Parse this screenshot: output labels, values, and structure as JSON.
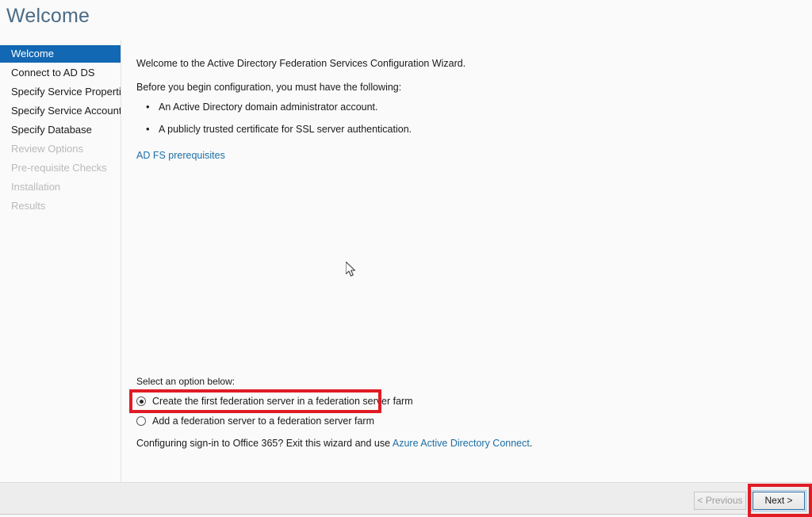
{
  "header": {
    "title": "Welcome"
  },
  "sidebar": {
    "items": [
      {
        "label": "Welcome",
        "state": "selected"
      },
      {
        "label": "Connect to AD DS",
        "state": "enabled"
      },
      {
        "label": "Specify Service Properties",
        "state": "enabled"
      },
      {
        "label": "Specify Service Account",
        "state": "enabled"
      },
      {
        "label": "Specify Database",
        "state": "enabled"
      },
      {
        "label": "Review Options",
        "state": "disabled"
      },
      {
        "label": "Pre-requisite Checks",
        "state": "disabled"
      },
      {
        "label": "Installation",
        "state": "disabled"
      },
      {
        "label": "Results",
        "state": "disabled"
      }
    ]
  },
  "content": {
    "intro_line_1": "Welcome to the Active Directory Federation Services Configuration Wizard.",
    "intro_line_2": "Before you begin configuration, you must have the following:",
    "requirements": [
      "An Active Directory domain administrator account.",
      "A publicly trusted certificate for SSL server authentication."
    ],
    "prerequisites_link": "AD FS prerequisites",
    "option_label": "Select an option below:",
    "options": [
      {
        "label": "Create the first federation server in a federation server farm",
        "selected": true
      },
      {
        "label": "Add a federation server to a federation server farm",
        "selected": false
      }
    ],
    "office_note_prefix": "Configuring sign-in to Office 365? Exit this wizard and use ",
    "office_note_link": "Azure Active Directory Connect",
    "office_note_suffix": "."
  },
  "footer": {
    "previous_label": "< Previous",
    "next_label": "Next >"
  },
  "colors": {
    "accent_blue": "#1268b3",
    "link_blue": "#1c6ea4",
    "title_blue": "#4a6b86",
    "annotation_red": "#e01b24",
    "disabled_gray": "#b9b9b9",
    "page_background": "#fafafa",
    "footer_background": "#ededed"
  }
}
